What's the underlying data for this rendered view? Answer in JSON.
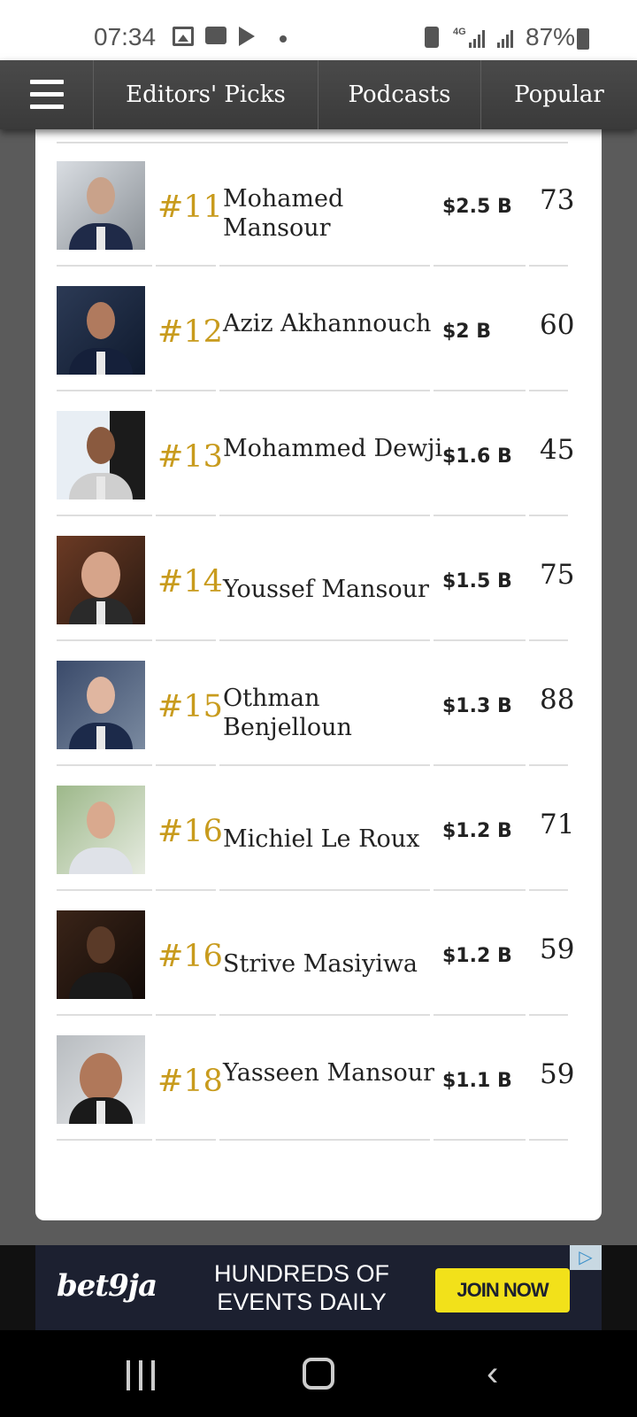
{
  "status_bar": {
    "time": "07:34",
    "battery": "87%",
    "network": "4G",
    "icons": [
      "gallery-icon",
      "chat-icon",
      "play-store-icon",
      "dot-icon",
      "battery-saver-icon",
      "signal-icon",
      "signal-icon",
      "battery-icon"
    ]
  },
  "nav": {
    "menu_icon": "hamburger-icon",
    "tabs": [
      {
        "label": "Editors' Picks"
      },
      {
        "label": "Podcasts"
      },
      {
        "label": "Popular"
      }
    ]
  },
  "rankings": [
    {
      "rank": "#11",
      "name": "Mohamed Mansour",
      "worth": "$2.5 B",
      "age": "73"
    },
    {
      "rank": "#12",
      "name": "Aziz Akhannouch",
      "worth": "$2 B",
      "age": "60"
    },
    {
      "rank": "#13",
      "name": "Mohammed Dewji",
      "worth": "$1.6 B",
      "age": "45"
    },
    {
      "rank": "#14",
      "name": "Youssef Mansour",
      "worth": "$1.5 B",
      "age": "75"
    },
    {
      "rank": "#15",
      "name": "Othman Benjelloun",
      "worth": "$1.3 B",
      "age": "88"
    },
    {
      "rank": "#16",
      "name": "Michiel Le Roux",
      "worth": "$1.2 B",
      "age": "71"
    },
    {
      "rank": "#16",
      "name": "Strive Masiyiwa",
      "worth": "$1.2 B",
      "age": "59"
    },
    {
      "rank": "#18",
      "name": "Yasseen Mansour",
      "worth": "$1.1 B",
      "age": "59"
    }
  ],
  "ad": {
    "brand": "bet9ja",
    "text": "HUNDREDS OF EVENTS DAILY",
    "cta": "JOIN NOW",
    "choices_icon": "ad-choices-icon"
  },
  "colors": {
    "rank": "#c89b1d",
    "nav_bg": "#3f3f3f",
    "ad_bg": "#1c2030",
    "ad_button": "#f2e11a"
  }
}
